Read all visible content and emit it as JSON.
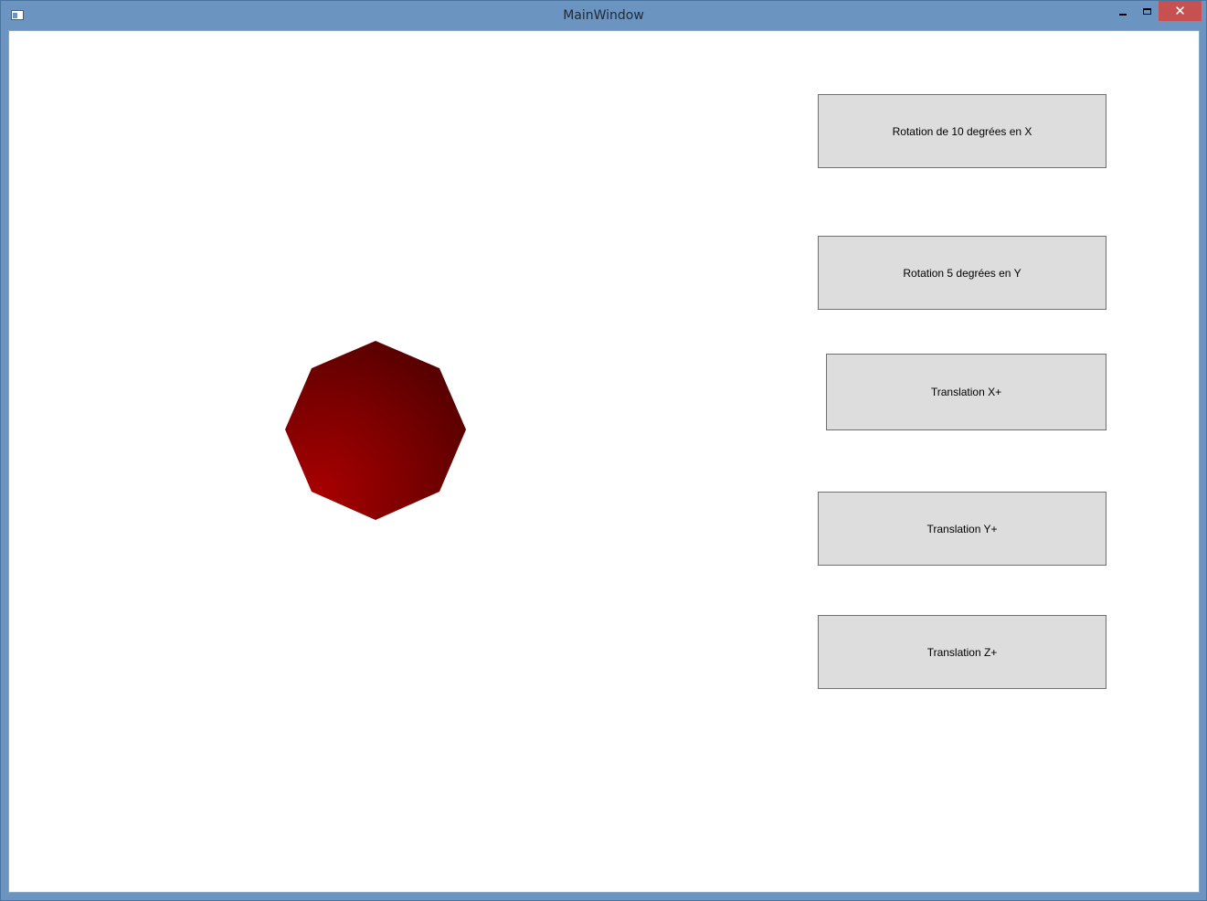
{
  "window": {
    "title": "MainWindow",
    "close_glyph": "✕"
  },
  "scene": {
    "shape": "octagon",
    "color_light": "#a80000",
    "color_mid": "#7a0000",
    "color_dark": "#520000"
  },
  "buttons": {
    "rotate_x": "Rotation de 10 degrées en X",
    "rotate_y": "Rotation 5 degrées en Y",
    "translate_x": "Translation X+",
    "translate_y": "Translation Y+",
    "translate_z": "Translation Z+"
  },
  "icons": {
    "app": "window-app-icon",
    "minimize": "minimize-icon",
    "maximize": "maximize-icon",
    "close": "close-icon"
  }
}
